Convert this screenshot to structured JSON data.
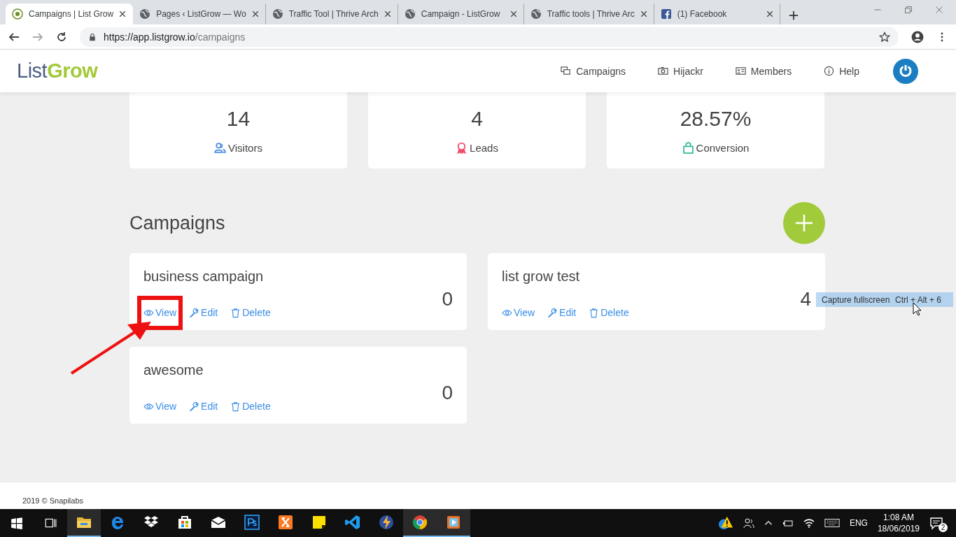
{
  "browser": {
    "tabs": [
      {
        "title": "Campaigns | List Grow",
        "kind": "site",
        "selected": true
      },
      {
        "title": "Pages ‹ ListGrow — Wo",
        "kind": "globe",
        "selected": false
      },
      {
        "title": "Traffic Tool | Thrive Arch",
        "kind": "globe",
        "selected": false
      },
      {
        "title": "Campaign - ListGrow",
        "kind": "globe",
        "selected": false
      },
      {
        "title": "Traffic tools | Thrive Arc",
        "kind": "globe",
        "selected": false
      },
      {
        "title": "(1) Facebook",
        "kind": "facebook",
        "selected": false
      }
    ],
    "url": {
      "host": "https://app.listgrow.io",
      "path": "/campaigns"
    }
  },
  "header": {
    "logo": {
      "first": "List",
      "second": "Grow"
    },
    "nav": [
      {
        "label": "Campaigns",
        "kind": "copy"
      },
      {
        "label": "Hijackr",
        "kind": "camera"
      },
      {
        "label": "Members",
        "kind": "card"
      },
      {
        "label": "Help",
        "kind": "info"
      }
    ]
  },
  "stats": [
    {
      "value": "14",
      "label": "Visitors",
      "kind": "users",
      "color": "#4a90e2"
    },
    {
      "value": "4",
      "label": "Leads",
      "kind": "award",
      "color": "#f0506e"
    },
    {
      "value": "28.57%",
      "label": "Conversion",
      "kind": "bag",
      "color": "#2fb89a"
    }
  ],
  "section_title": "Campaigns",
  "campaigns": [
    {
      "name": "business campaign",
      "count": "0",
      "actions": [
        {
          "label": "View",
          "kind": "view",
          "highlighted": true
        },
        {
          "label": "Edit",
          "kind": "edit",
          "highlighted": false
        },
        {
          "label": "Delete",
          "kind": "delete",
          "highlighted": false
        }
      ]
    },
    {
      "name": "list grow test",
      "count": "4",
      "actions": [
        {
          "label": "View",
          "kind": "view",
          "highlighted": false
        },
        {
          "label": "Edit",
          "kind": "edit",
          "highlighted": false
        },
        {
          "label": "Delete",
          "kind": "delete",
          "highlighted": false
        }
      ]
    },
    {
      "name": "awesome",
      "count": "0",
      "actions": [
        {
          "label": "View",
          "kind": "view",
          "highlighted": false
        },
        {
          "label": "Edit",
          "kind": "edit",
          "highlighted": false
        },
        {
          "label": "Delete",
          "kind": "delete",
          "highlighted": false
        }
      ]
    }
  ],
  "tooltip": {
    "label": "Capture fullscreen",
    "shortcut": "Ctrl + Alt + 6"
  },
  "footer": "2019 © Snapilabs",
  "taskbar": {
    "apps": [
      {
        "kind": "explorer",
        "open": true
      },
      {
        "kind": "edge",
        "open": false
      },
      {
        "kind": "dropbox",
        "open": false
      },
      {
        "kind": "store",
        "open": false
      },
      {
        "kind": "mail",
        "open": false
      },
      {
        "kind": "ps",
        "open": false
      },
      {
        "kind": "xampp",
        "open": false
      },
      {
        "kind": "notes",
        "open": false
      },
      {
        "kind": "vscode",
        "open": false
      },
      {
        "kind": "bolt",
        "open": false
      },
      {
        "kind": "chrome",
        "open": true
      },
      {
        "kind": "player",
        "open": true
      }
    ],
    "language": "ENG",
    "time": "1:08 AM",
    "date": "18/06/2019",
    "notifications": "2"
  }
}
